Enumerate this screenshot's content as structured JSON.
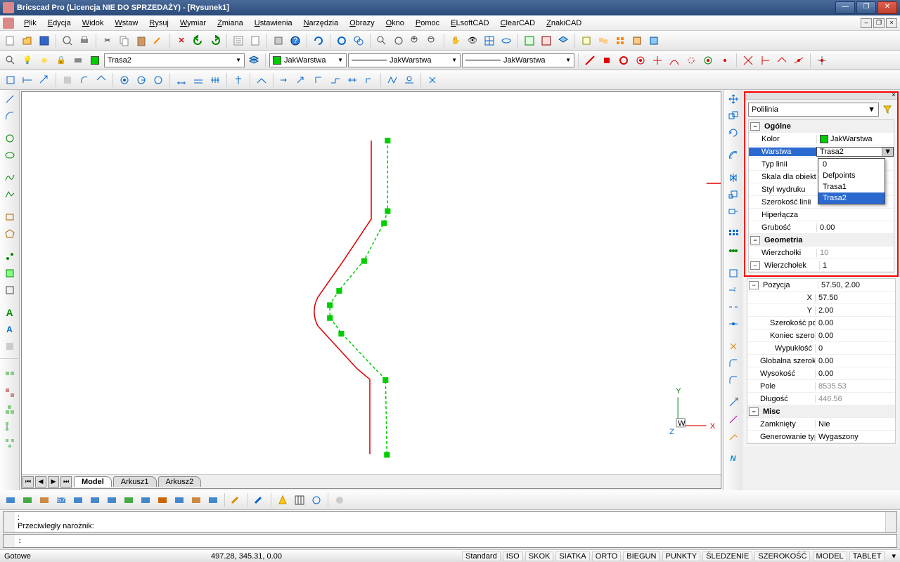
{
  "title": "Bricscad Pro (Licencja NIE DO SPRZEDAŻY) - [Rysunek1]",
  "menu": [
    "Plik",
    "Edycja",
    "Widok",
    "Wstaw",
    "Rysuj",
    "Wymiar",
    "Zmiana",
    "Ustawienia",
    "Narzędzia",
    "Obrazy",
    "Okno",
    "Pomoc",
    "ELsoftCAD",
    "ClearCAD",
    "ZnakiCAD"
  ],
  "layer_combo": "Trasa2",
  "color_combo": "JakWarstwa",
  "ltype_combo": "JakWarstwa",
  "lweight_combo": "JakWarstwa",
  "tabs": {
    "active": "Model",
    "others": [
      "Arkusz1",
      "Arkusz2"
    ]
  },
  "props": {
    "object": "Polilinia",
    "groups": {
      "ogolne": "Ogólne",
      "geometria": "Geometria",
      "misc": "Misc"
    },
    "rows": {
      "kolor_k": "Kolor",
      "kolor_v": "JakWarstwa",
      "warstwa_k": "Warstwa",
      "warstwa_v": "Trasa2",
      "typlinii_k": "Typ linii",
      "skala_k": "Skala dla obiektu",
      "styl_k": "Styl wydruku",
      "szer_k": "Szerokość linii",
      "hiper_k": "Hiperłącza",
      "grub_k": "Grubość",
      "grub_v": "0.00",
      "wierz_k": "Wierzchołki",
      "wierz_v": "10",
      "wierzn_k": "Wierzchołek",
      "wierzn_v": "1",
      "poz_k": "Pozycja",
      "poz_v": "57.50, 2.00",
      "x_k": "X",
      "x_v": "57.50",
      "y_k": "Y",
      "y_v": "2.00",
      "szp_k": "Szerokość poc",
      "szp_v": "0.00",
      "ks_k": "Koniec szerok",
      "ks_v": "0.00",
      "wyp_k": "Wypukłość",
      "wyp_v": "0",
      "gsz_k": "Globalna szeroko",
      "gsz_v": "0.00",
      "wys_k": "Wysokość",
      "wys_v": "0.00",
      "pole_k": "Pole",
      "pole_v": "8535.53",
      "dlug_k": "Długość",
      "dlug_v": "446.56",
      "zam_k": "Zamknięty",
      "zam_v": "Nie",
      "gen_k": "Generowanie typ",
      "gen_v": "Wygaszony"
    },
    "dropdown": [
      "0",
      "Defpoints",
      "Trasa1",
      "Trasa2"
    ]
  },
  "cmd": {
    "line1": ":",
    "line2": "Przeciwległy narożnik:",
    "input": ":"
  },
  "status": {
    "left": "Gotowe",
    "coords": "497.28, 345.31, 0.00",
    "segs": [
      "Standard",
      "ISO",
      "SKOK",
      "SIATKA",
      "ORTO",
      "BIEGUN",
      "PUNKTY",
      "ŚLEDZENIE",
      "SZEROKOŚĆ",
      "MODEL",
      "TABLET"
    ]
  },
  "ucs": {
    "x": "X",
    "y": "Y",
    "z": "Z",
    "w": "W"
  }
}
